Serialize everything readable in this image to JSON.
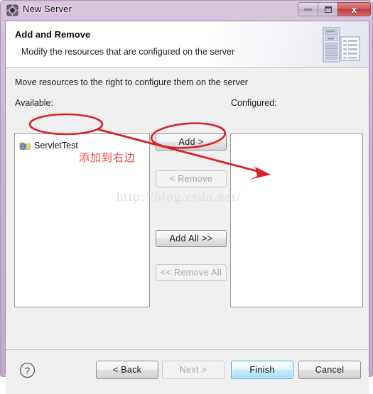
{
  "window": {
    "title": "New Server",
    "title_icon": "server-gear-icon",
    "controls": {
      "minimize": "minimize-icon",
      "restore": "restore-icon",
      "close": "x"
    }
  },
  "header": {
    "title": "Add and Remove",
    "subtitle": "Modify the resources that are configured on the server",
    "icon": "server-and-document-icon"
  },
  "main": {
    "instruction": "Move resources to the right to configure them on the server",
    "available_label": "Available:",
    "configured_label": "Configured:",
    "available_items": [
      {
        "label": "ServletTest",
        "icon": "web-project-icon"
      }
    ],
    "configured_items": [],
    "buttons": [
      {
        "label": "Add >",
        "enabled": true
      },
      {
        "label": "< Remove",
        "enabled": false
      },
      {
        "label": "Add All >>",
        "enabled": true
      },
      {
        "label": "<< Remove All",
        "enabled": false
      }
    ]
  },
  "footer": {
    "help_icon": "?",
    "back_label": "< Back",
    "next_label": "Next >",
    "finish_label": "Finish",
    "cancel_label": "Cancel"
  },
  "annotations": {
    "note_text": "添加到右边",
    "color": "#e8423f",
    "shapes": [
      "ellipse-around-servlettest",
      "ellipse-around-add-button",
      "arrow-to-configured-list"
    ]
  },
  "watermark": {
    "text": "http://blog.csdn.net/"
  },
  "colors": {
    "window_frame": "#c7b0d0",
    "accent_finish": "#2fa8d8",
    "close_button": "#cf5d5d",
    "annotation_red": "#e8423f"
  }
}
